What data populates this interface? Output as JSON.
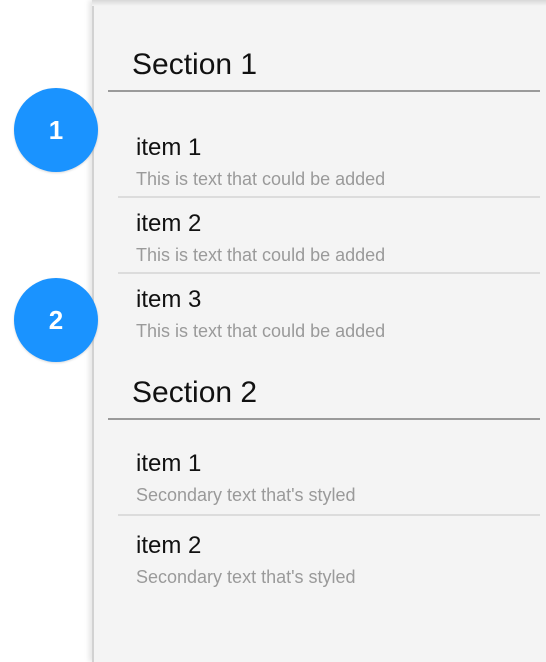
{
  "sections": [
    {
      "title": "Section 1",
      "items": [
        {
          "primary": "item 1",
          "secondary": "This is text that could be added"
        },
        {
          "primary": "item 2",
          "secondary": "This is text that could be added"
        },
        {
          "primary": "item 3",
          "secondary": "This is text that could be added"
        }
      ]
    },
    {
      "title": "Section 2",
      "items": [
        {
          "primary": "item 1",
          "secondary": "Secondary text that's styled"
        },
        {
          "primary": "item 2",
          "secondary": "Secondary text that's styled"
        }
      ]
    }
  ],
  "callouts": [
    {
      "label": "1"
    },
    {
      "label": "2"
    }
  ],
  "colors": {
    "callout": "#1a93ff",
    "panel": "#f4f4f4",
    "secondary_text": "#9a9a9a"
  }
}
